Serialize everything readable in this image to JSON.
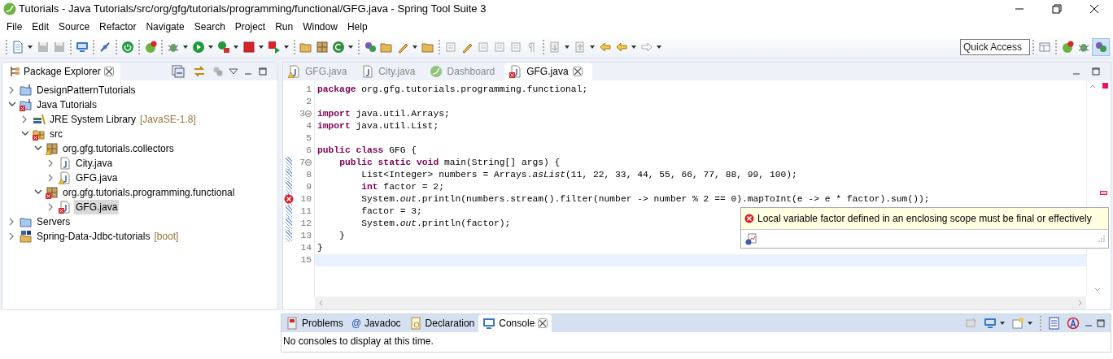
{
  "window": {
    "title": "Tutorials - Java Tutorials/src/org/gfg/tutorials/programming/functional/GFG.java - Spring Tool Suite 3"
  },
  "menu": [
    "File",
    "Edit",
    "Source",
    "Refactor",
    "Navigate",
    "Search",
    "Project",
    "Run",
    "Window",
    "Help"
  ],
  "quick_access": {
    "placeholder": "Quick Access"
  },
  "package_explorer": {
    "title": "Package Explorer",
    "tree": [
      {
        "label": "DesignPatternTutorials",
        "kind": "project",
        "expanded": false,
        "selected": false
      },
      {
        "label": "Java Tutorials",
        "kind": "project",
        "error": true,
        "expanded": true,
        "selected": false,
        "children": [
          {
            "label": "JRE System Library",
            "decoration": "[JavaSE-1.8]",
            "kind": "library",
            "expanded": false,
            "selected": false
          },
          {
            "label": "src",
            "kind": "source-folder",
            "error": true,
            "expanded": true,
            "selected": false,
            "children": [
              {
                "label": "org.gfg.tutorials.collectors",
                "kind": "package",
                "warning": true,
                "expanded": true,
                "selected": false,
                "children": [
                  {
                    "label": "City.java",
                    "kind": "java-file",
                    "expanded": false,
                    "selected": false
                  },
                  {
                    "label": "GFG.java",
                    "kind": "java-file",
                    "warning": true,
                    "expanded": false,
                    "selected": false
                  }
                ]
              },
              {
                "label": "org.gfg.tutorials.programming.functional",
                "kind": "package",
                "error": true,
                "expanded": true,
                "selected": false,
                "children": [
                  {
                    "label": "GFG.java",
                    "kind": "java-file",
                    "error": true,
                    "expanded": false,
                    "selected": true
                  }
                ]
              }
            ]
          }
        ]
      },
      {
        "label": "Servers",
        "kind": "folder",
        "expanded": false,
        "selected": false
      },
      {
        "label": "Spring-Data-Jdbc-tutorials",
        "decoration": "[boot]",
        "kind": "boot-project",
        "expanded": false,
        "selected": false
      }
    ]
  },
  "editor": {
    "tabs": [
      {
        "label": "GFG.java",
        "kind": "java",
        "warning": true,
        "selected": false
      },
      {
        "label": "City.java",
        "kind": "java",
        "selected": false
      },
      {
        "label": "Dashboard",
        "kind": "spring",
        "selected": false
      },
      {
        "label": "GFG.java",
        "kind": "java",
        "error": true,
        "selected": true
      }
    ],
    "lines": [
      {
        "number": "1",
        "code": "**package** org.gfg.tutorials.programming.functional;"
      },
      {
        "number": "2"
      },
      {
        "number": "3",
        "code": "**import** java.util.Arrays;",
        "fold": true
      },
      {
        "number": "4",
        "code": "**import** java.util.List;"
      },
      {
        "number": "5"
      },
      {
        "number": "6",
        "code": "**public** **class** GFG {"
      },
      {
        "number": "7",
        "code": "    **public** **static** **void** main(String[] args) {",
        "fold": true,
        "changed": true
      },
      {
        "number": "8",
        "code": "        List<Integer> numbers = Arrays.*asList*(11, 22, 33, 44, 55, 66, 77, 88, 99, 100);",
        "changed": true
      },
      {
        "number": "9",
        "code": "        **int** factor = 2;",
        "changed": true
      },
      {
        "number": "10",
        "code": "        System.*out*.println(numbers.stream().filter(number -> number % 2 == 0).mapToInt(e -> e * factor).sum());",
        "changed": true,
        "error": true
      },
      {
        "number": "11",
        "code": "        factor = 3;",
        "changed": true
      },
      {
        "number": "12",
        "code": "        System.*out*.println(factor);",
        "changed": true
      },
      {
        "number": "13",
        "code": "    }",
        "changed": true
      },
      {
        "number": "14",
        "code": "}"
      },
      {
        "number": "15",
        "current": true
      }
    ],
    "error_tooltip": {
      "message": "Local variable factor defined in an enclosing scope must be final or effectively"
    }
  },
  "bottom_panel": {
    "tabs": [
      {
        "label": "Problems",
        "kind": "problems",
        "selected": false
      },
      {
        "label": "Javadoc",
        "kind": "javadoc",
        "icon_text": "@",
        "selected": false
      },
      {
        "label": "Declaration",
        "kind": "declaration",
        "selected": false
      },
      {
        "label": "Console",
        "kind": "console",
        "selected": true
      }
    ],
    "message": "No consoles to display at this time."
  }
}
